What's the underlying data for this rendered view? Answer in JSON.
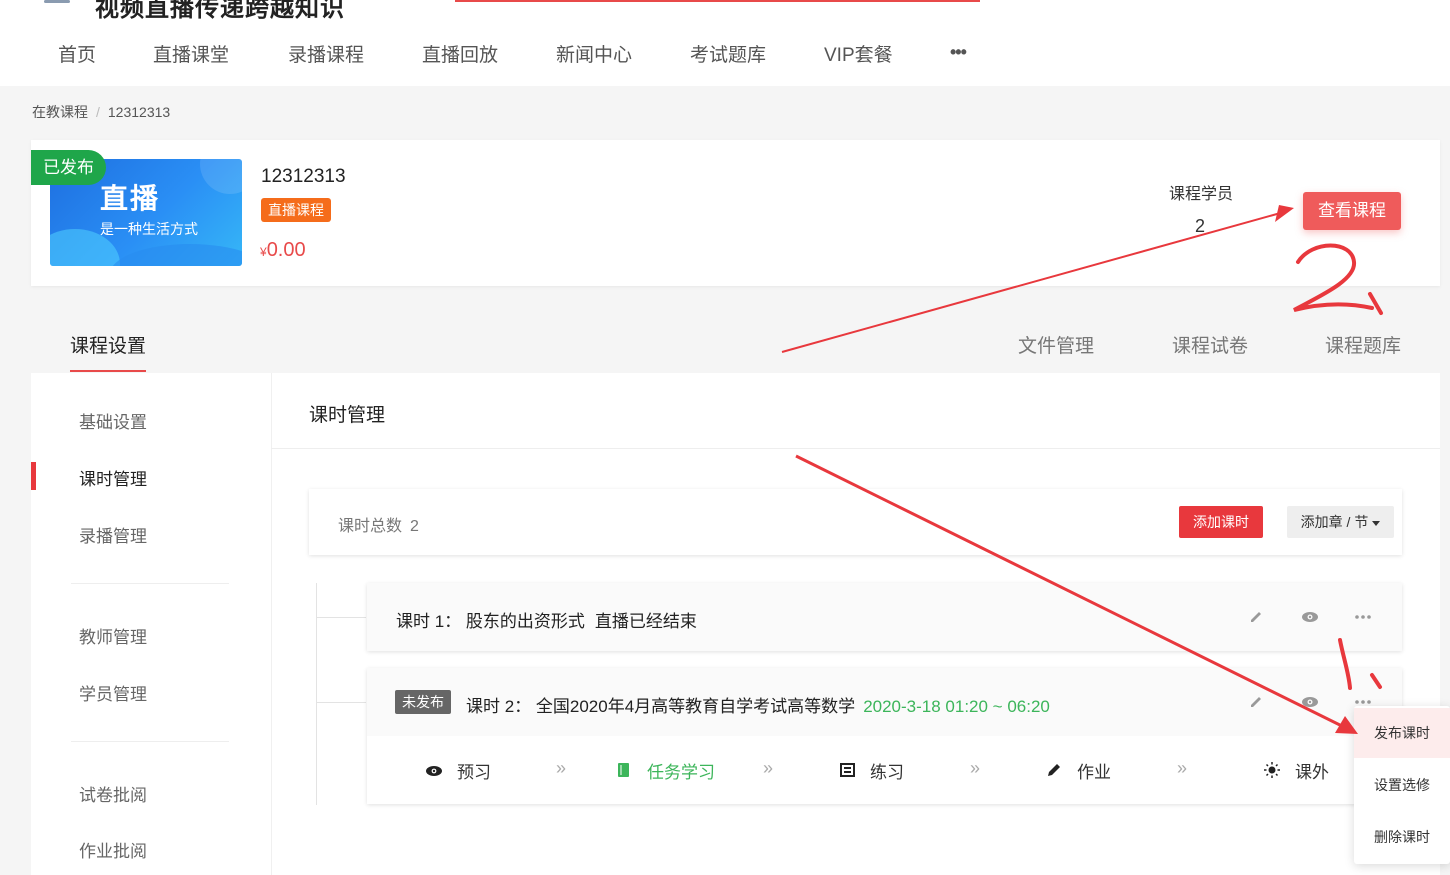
{
  "header": {
    "site_title": "视频直播传递跨越知识",
    "nav": [
      {
        "label": "首页"
      },
      {
        "label": "直播课堂"
      },
      {
        "label": "录播课程"
      },
      {
        "label": "直播回放"
      },
      {
        "label": "新闻中心"
      },
      {
        "label": "考试题库"
      },
      {
        "label": "VIP套餐"
      },
      {
        "label": "•••"
      }
    ]
  },
  "breadcrumb": {
    "parent": "在教课程",
    "sep": "/",
    "current": "12312313"
  },
  "course": {
    "badge": "已发布",
    "cover_title": "直播",
    "cover_subtitle": "是一种生活方式",
    "name": "12312313",
    "tag": "直播课程",
    "price_symbol": "¥",
    "price": "0.00",
    "students_label": "课程学员",
    "students_count": "2",
    "view_button": "查看课程"
  },
  "tabs": {
    "settings": "课程设置",
    "files": "文件管理",
    "papers": "课程试卷",
    "question_bank": "课程题库"
  },
  "sidebar": {
    "items": [
      {
        "label": "基础设置"
      },
      {
        "label": "课时管理"
      },
      {
        "label": "录播管理"
      },
      {
        "label": "教师管理"
      },
      {
        "label": "学员管理"
      },
      {
        "label": "试卷批阅"
      },
      {
        "label": "作业批阅"
      }
    ]
  },
  "content": {
    "title": "课时管理",
    "summary_label": "课时总数",
    "summary_count": "2",
    "add_lesson": "添加课时",
    "add_chapter": "添加章 / 节"
  },
  "lessons": [
    {
      "title": "课时 1： 股东的出资形式",
      "status": "直播已经结束"
    },
    {
      "badge": "未发布",
      "title": "课时 2： 全国2020年4月高等教育自学考试高等数学",
      "time": "2020-3-18 01:20 ~ 06:20"
    }
  ],
  "steps": [
    {
      "label": "预习",
      "icon": "eye-icon"
    },
    {
      "label": "任务学习",
      "icon": "book-icon"
    },
    {
      "label": "练习",
      "icon": "list-icon"
    },
    {
      "label": "作业",
      "icon": "pencil-icon"
    },
    {
      "label": "课外",
      "icon": "sun-icon"
    }
  ],
  "dropdown": {
    "items": [
      {
        "label": "发布课时"
      },
      {
        "label": "设置选修"
      },
      {
        "label": "删除课时"
      }
    ]
  },
  "annotations": [
    "2、",
    "1、"
  ],
  "colors": {
    "accent": "#e8383d",
    "green": "#3cb55a",
    "orange": "#f56c1b",
    "published": "#1fa64a"
  }
}
